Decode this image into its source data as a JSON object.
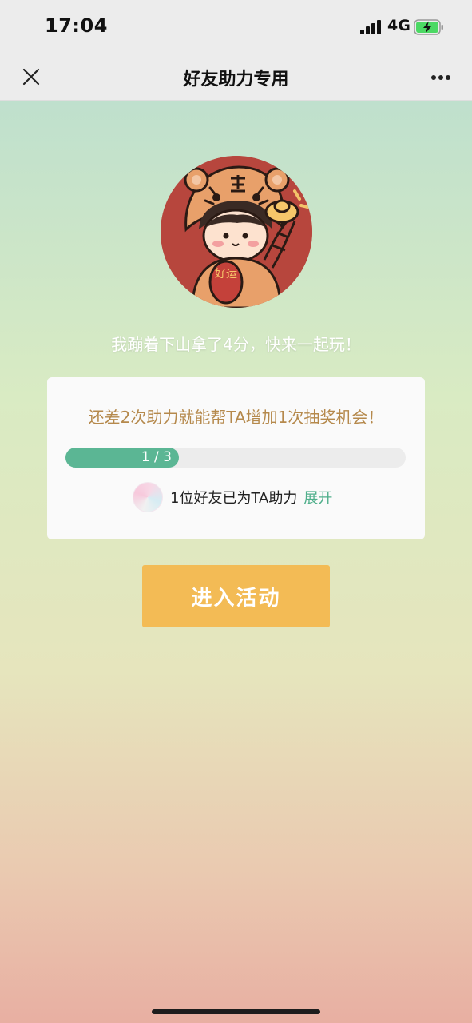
{
  "status_bar": {
    "time": "17:04",
    "network": "4G",
    "battery_color": "#4cd964"
  },
  "nav": {
    "title": "好友助力专用",
    "close_icon": "close-icon",
    "more_icon": "more-icon"
  },
  "avatar": {
    "icon": "tiger-girl-avatar-icon",
    "badge_text": "好运"
  },
  "share_text": "我蹦着下山拿了4分，快来一起玩！",
  "card": {
    "message": "还差2次助力就能帮TA增加1次抽奖机会！",
    "progress": {
      "current": 1,
      "total": 3,
      "label": "1 / 3",
      "color": "#5bb694"
    },
    "friends_text": "1位好友已为TA助力",
    "expand_label": "展开",
    "accent_color": "#b5894c"
  },
  "enter_button": {
    "label": "进入活动",
    "color": "#f3bb55"
  }
}
